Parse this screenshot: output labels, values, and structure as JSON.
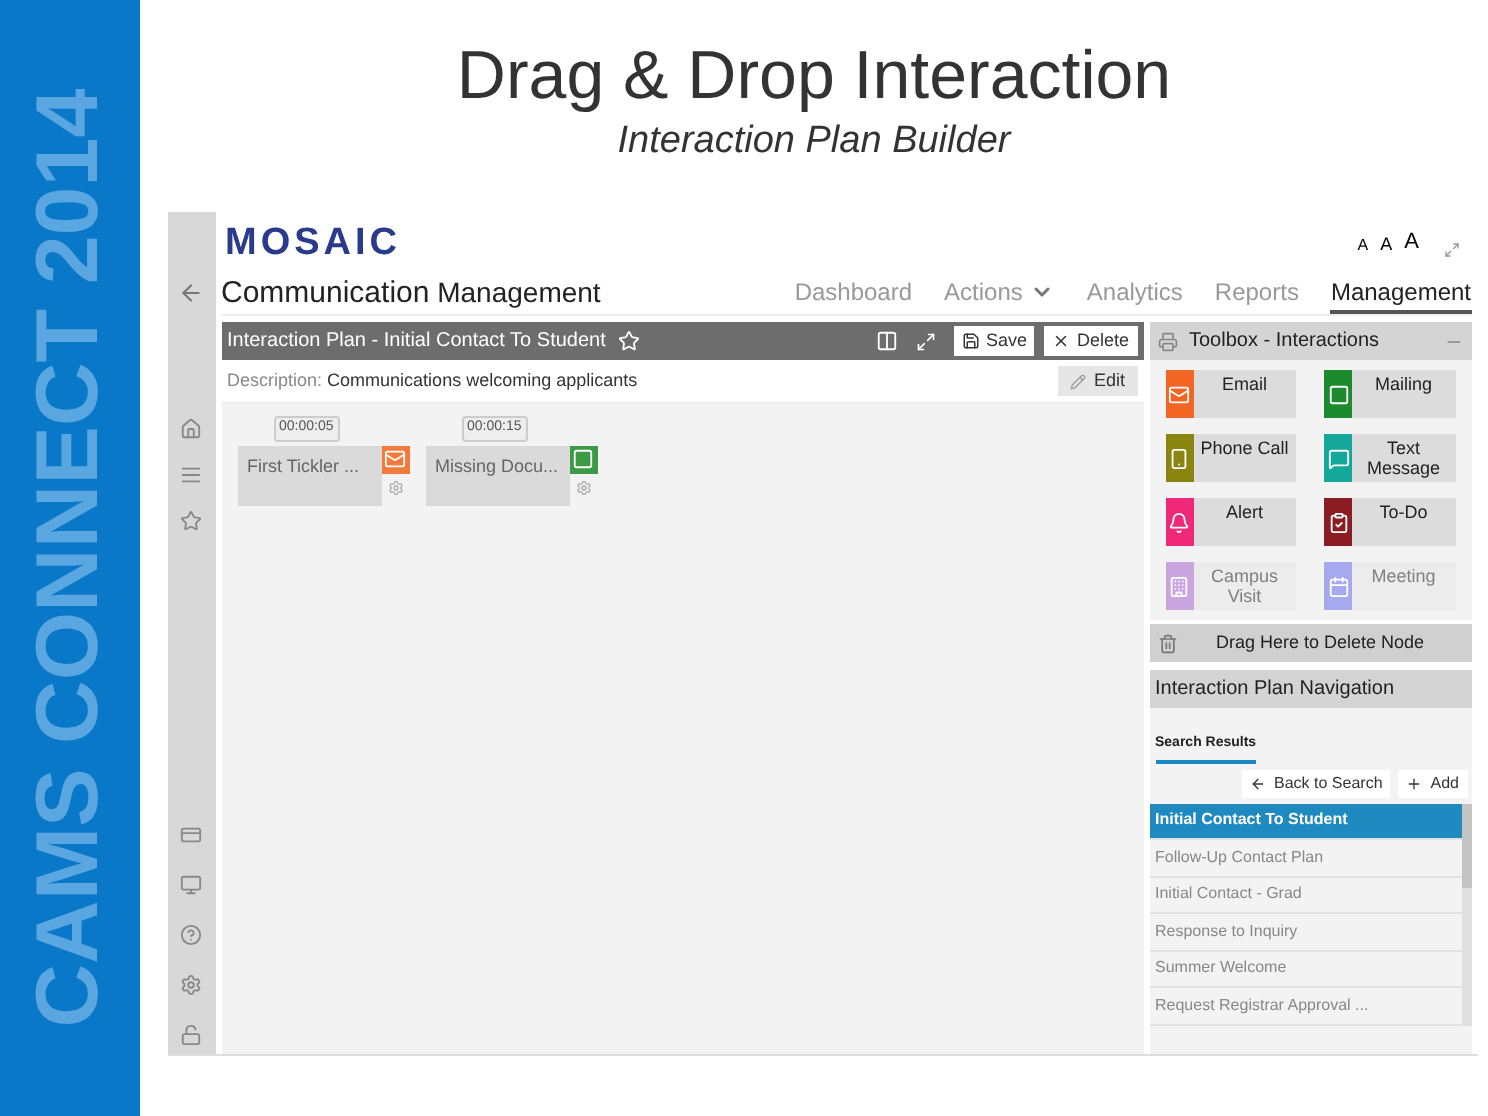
{
  "slide": {
    "band_text": "CAMS CONNECT 2014",
    "title": "Drag & Drop Interaction",
    "subtitle": "Interaction Plan Builder"
  },
  "app": {
    "logo": "MOSAIC",
    "font_sizes": [
      "A",
      "A",
      "A"
    ],
    "page_title": {
      "main": "Communication",
      "rest": "Management"
    },
    "nav": [
      {
        "label": "Dashboard",
        "kind": "link",
        "selected": false
      },
      {
        "label": "Actions",
        "kind": "dropdown",
        "selected": false
      },
      {
        "label": "Analytics",
        "kind": "link",
        "selected": false
      },
      {
        "label": "Reports",
        "kind": "link",
        "selected": false
      },
      {
        "label": "Management",
        "kind": "link",
        "selected": true
      }
    ],
    "plan_bar": {
      "title": "Interaction Plan - Initial Contact To Student",
      "buttons": [
        "Save",
        "Delete"
      ]
    },
    "description": {
      "label": "Description:",
      "value": "Communications welcoming applicants",
      "edit": "Edit"
    },
    "nodes": [
      {
        "time": "00:00:05",
        "label": "First Tickler ...",
        "kind": "email",
        "color": "#f27a3c"
      },
      {
        "time": "00:00:15",
        "label": "Missing Docu...",
        "kind": "mailing",
        "color": "#3a9a46"
      }
    ],
    "toolbox": {
      "title": "Toolbox - Interactions",
      "items": [
        {
          "label": "Email",
          "kind": "email",
          "color": "#f26522",
          "disabled": false
        },
        {
          "label": "Mailing",
          "kind": "mailing",
          "color": "#1e8a2e",
          "disabled": false
        },
        {
          "label": "Phone Call",
          "kind": "phone",
          "color": "#8a8410",
          "disabled": false
        },
        {
          "label": "Text Message",
          "kind": "text",
          "color": "#14a89a",
          "disabled": false
        },
        {
          "label": "Alert",
          "kind": "alert",
          "color": "#f0287a",
          "disabled": false
        },
        {
          "label": "To-Do",
          "kind": "todo",
          "color": "#8a1c22",
          "disabled": false
        },
        {
          "label": "Campus Visit",
          "kind": "visit",
          "color": "#c9a6e0",
          "disabled": true
        },
        {
          "label": "Meeting",
          "kind": "meeting",
          "color": "#a6a8f0",
          "disabled": true
        }
      ],
      "delete_zone": "Drag Here to Delete Node"
    },
    "navigation": {
      "title": "Interaction Plan Navigation",
      "tab": {
        "label": "Search Results",
        "selected": true
      },
      "back": "Back to Search",
      "add": "Add",
      "items": [
        {
          "label": "Initial Contact To Student",
          "selected": true
        },
        {
          "label": "Follow-Up Contact Plan",
          "selected": false
        },
        {
          "label": "Initial Contact - Grad",
          "selected": false
        },
        {
          "label": "Response to Inquiry",
          "selected": false
        },
        {
          "label": "Summer Welcome",
          "selected": false
        },
        {
          "label": "Request Registrar Approval ...",
          "selected": false
        }
      ]
    }
  }
}
